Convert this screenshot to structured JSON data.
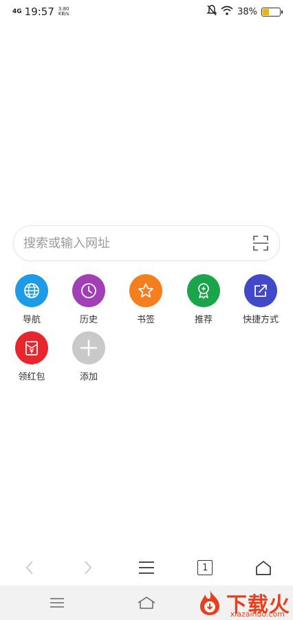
{
  "status_bar": {
    "network": "4G",
    "time": "19:57",
    "speed_value": "3.80",
    "speed_unit": "KB/s",
    "battery_percent": "38%",
    "battery_level": 0.38
  },
  "search": {
    "placeholder": "搜索或输入网址"
  },
  "shortcuts": [
    {
      "label": "导航",
      "icon": "globe-icon",
      "color": "#1e9be8"
    },
    {
      "label": "历史",
      "icon": "clock-icon",
      "color": "#a33fb6"
    },
    {
      "label": "书签",
      "icon": "star-icon",
      "color": "#f57f1f"
    },
    {
      "label": "推荐",
      "icon": "badge-icon",
      "color": "#1aa54a"
    },
    {
      "label": "快捷方式",
      "icon": "share-icon",
      "color": "#4149c9"
    },
    {
      "label": "领红包",
      "icon": "red-packet-icon",
      "color": "#e8262e"
    },
    {
      "label": "添加",
      "icon": "plus-icon",
      "color": "#c9c9c9"
    }
  ],
  "toolbar": {
    "tab_count": "1"
  },
  "watermark": {
    "text": "下载火",
    "url": "xiazaihuo.com"
  },
  "colors": {
    "accent": "#e8401c",
    "battery": "#f0b400"
  }
}
